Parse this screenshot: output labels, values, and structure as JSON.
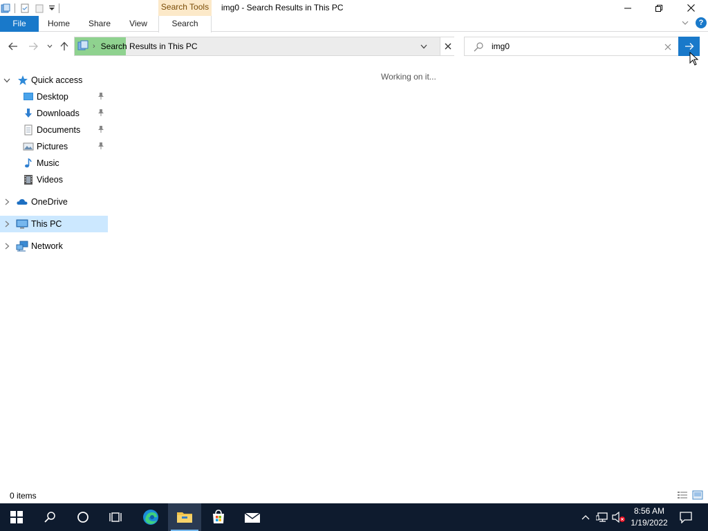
{
  "window": {
    "title": "img0 - Search Results in This PC",
    "contextual_tab_group": "Search Tools"
  },
  "ribbon": {
    "tabs": [
      {
        "label": "File"
      },
      {
        "label": "Home"
      },
      {
        "label": "Share"
      },
      {
        "label": "View"
      },
      {
        "label": "Search"
      }
    ]
  },
  "address": {
    "path": "Search Results in This PC"
  },
  "search": {
    "value": "img0"
  },
  "sidebar": {
    "items": [
      {
        "label": "Quick access",
        "icon": "star-icon"
      },
      {
        "label": "Desktop",
        "icon": "desktop-folder-icon",
        "pinned": true
      },
      {
        "label": "Downloads",
        "icon": "downloads-icon",
        "pinned": true
      },
      {
        "label": "Documents",
        "icon": "documents-icon",
        "pinned": true
      },
      {
        "label": "Pictures",
        "icon": "pictures-icon",
        "pinned": true
      },
      {
        "label": "Music",
        "icon": "music-icon"
      },
      {
        "label": "Videos",
        "icon": "videos-icon"
      },
      {
        "label": "OneDrive",
        "icon": "onedrive-icon"
      },
      {
        "label": "This PC",
        "icon": "this-pc-icon",
        "selected": true
      },
      {
        "label": "Network",
        "icon": "network-icon"
      }
    ]
  },
  "content": {
    "message": "Working on it..."
  },
  "status": {
    "item_count": "0 items"
  },
  "taskbar": {
    "time": "8:56 AM",
    "date": "1/19/2022"
  },
  "colors": {
    "accent": "#1979ca",
    "progress": "#8fd28f",
    "selection": "#cce8ff",
    "taskbar": "#0e1b2e",
    "contextual_tab": "#fce9c9"
  }
}
